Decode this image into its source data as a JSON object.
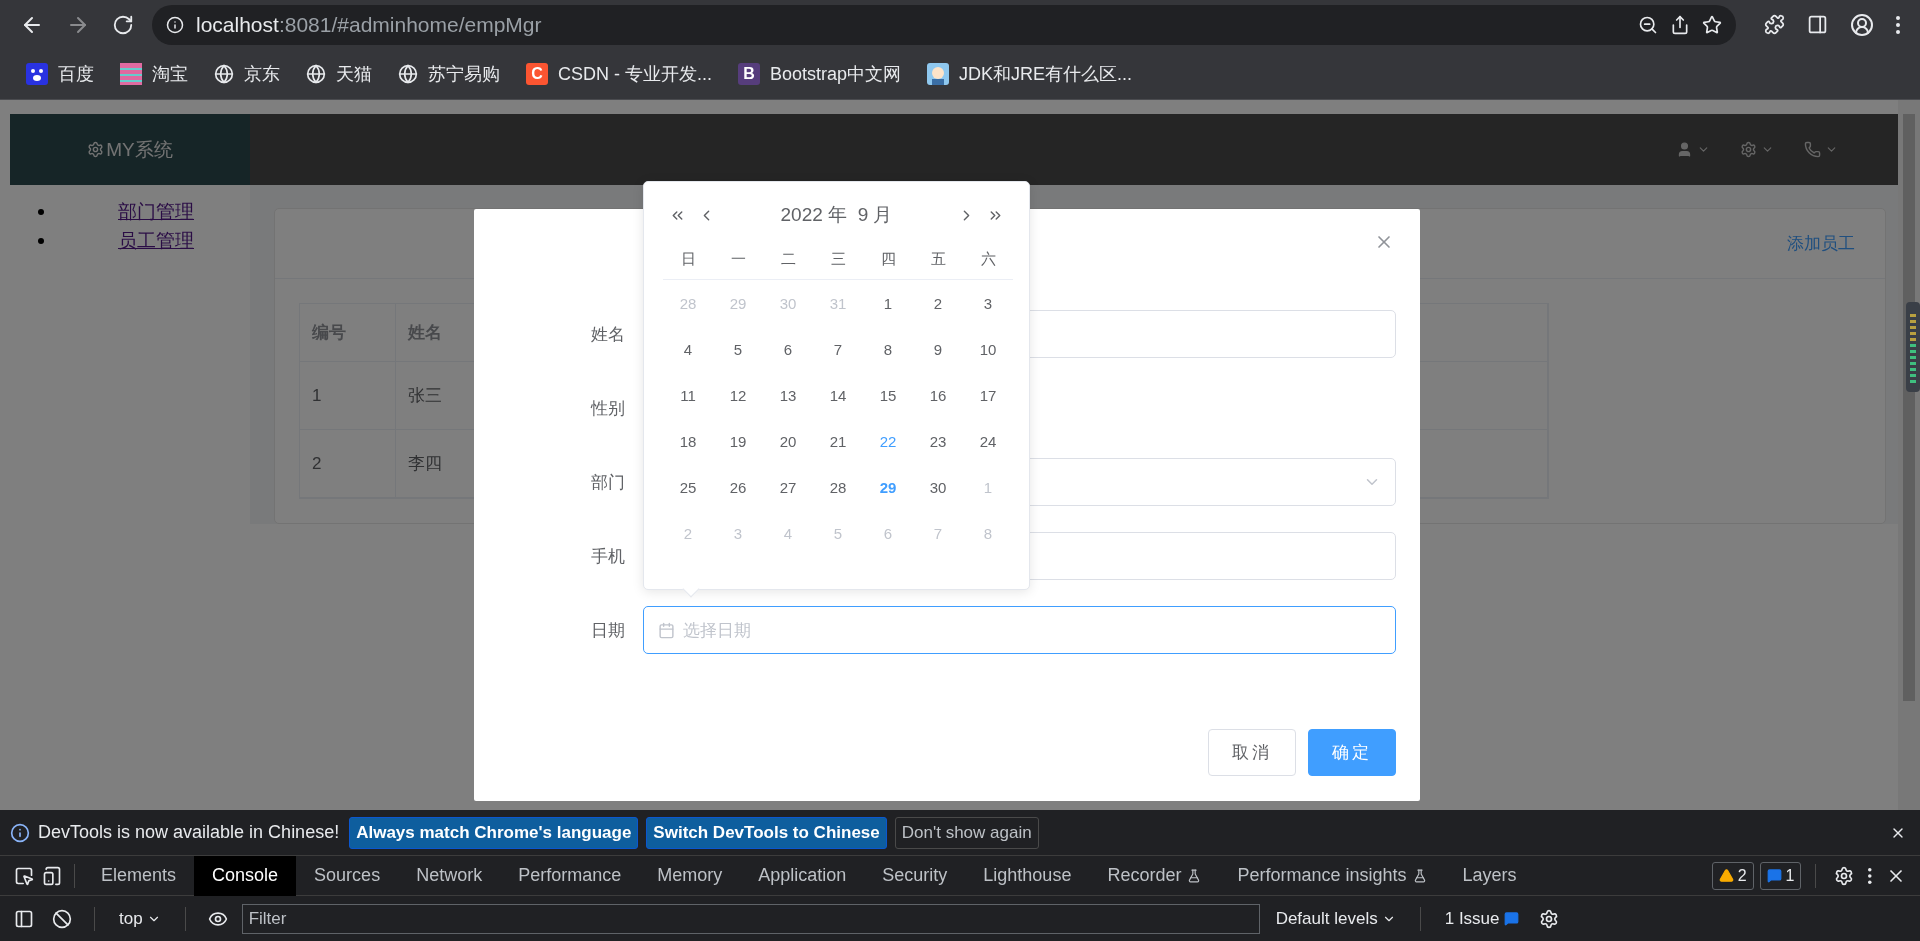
{
  "browser": {
    "url_host": "localhost",
    "url_path": ":8081/#adminhome/empMgr",
    "bookmarks": [
      {
        "label": "百度",
        "kind": "paw"
      },
      {
        "label": "淘宝",
        "kind": "pattern"
      },
      {
        "label": "京东",
        "kind": "globe"
      },
      {
        "label": "天猫",
        "kind": "globe"
      },
      {
        "label": "苏宁易购",
        "kind": "globe"
      },
      {
        "label": "CSDN - 专业开发...",
        "kind": "letter",
        "letter": "C",
        "color": "#fc5531"
      },
      {
        "label": "Bootstrap中文网",
        "kind": "letter",
        "letter": "B",
        "color": "#563d7c"
      },
      {
        "label": "JDK和JRE有什么区...",
        "kind": "avatar"
      }
    ]
  },
  "app": {
    "logo": "MY系统",
    "sidebar": [
      "部门管理",
      "员工管理"
    ],
    "card_action": "添加员工",
    "table": {
      "columns": [
        "编号",
        "姓名"
      ],
      "rows": [
        [
          "1",
          "张三"
        ],
        [
          "2",
          "李四"
        ]
      ]
    }
  },
  "dialog": {
    "fields": [
      {
        "label": "姓名",
        "kind": "input"
      },
      {
        "label": "性别",
        "kind": "covered"
      },
      {
        "label": "部门",
        "kind": "select"
      },
      {
        "label": "手机",
        "kind": "input"
      },
      {
        "label": "日期",
        "kind": "date",
        "placeholder": "选择日期"
      }
    ],
    "buttons": [
      {
        "label": "取消",
        "kind": "default"
      },
      {
        "label": "确定",
        "kind": "primary"
      }
    ]
  },
  "datepicker": {
    "year": "2022 年",
    "month": "9 月",
    "weekdays": [
      "日",
      "一",
      "二",
      "三",
      "四",
      "五",
      "六"
    ],
    "weeks": [
      [
        {
          "label": "28",
          "kind": "other"
        },
        {
          "label": "29",
          "kind": "other"
        },
        {
          "label": "30",
          "kind": "other"
        },
        {
          "label": "31",
          "kind": "other"
        },
        {
          "label": "1",
          "kind": "normal"
        },
        {
          "label": "2",
          "kind": "normal"
        },
        {
          "label": "3",
          "kind": "normal"
        }
      ],
      [
        {
          "label": "4",
          "kind": "normal"
        },
        {
          "label": "5",
          "kind": "normal"
        },
        {
          "label": "6",
          "kind": "normal"
        },
        {
          "label": "7",
          "kind": "normal"
        },
        {
          "label": "8",
          "kind": "normal"
        },
        {
          "label": "9",
          "kind": "normal"
        },
        {
          "label": "10",
          "kind": "normal"
        }
      ],
      [
        {
          "label": "11",
          "kind": "normal"
        },
        {
          "label": "12",
          "kind": "normal"
        },
        {
          "label": "13",
          "kind": "normal"
        },
        {
          "label": "14",
          "kind": "normal"
        },
        {
          "label": "15",
          "kind": "normal"
        },
        {
          "label": "16",
          "kind": "normal"
        },
        {
          "label": "17",
          "kind": "normal"
        }
      ],
      [
        {
          "label": "18",
          "kind": "normal"
        },
        {
          "label": "19",
          "kind": "normal"
        },
        {
          "label": "20",
          "kind": "normal"
        },
        {
          "label": "21",
          "kind": "normal"
        },
        {
          "label": "22",
          "kind": "marked"
        },
        {
          "label": "23",
          "kind": "normal"
        },
        {
          "label": "24",
          "kind": "normal"
        }
      ],
      [
        {
          "label": "25",
          "kind": "normal"
        },
        {
          "label": "26",
          "kind": "normal"
        },
        {
          "label": "27",
          "kind": "normal"
        },
        {
          "label": "28",
          "kind": "normal"
        },
        {
          "label": "29",
          "kind": "today"
        },
        {
          "label": "30",
          "kind": "normal"
        },
        {
          "label": "1",
          "kind": "other"
        }
      ],
      [
        {
          "label": "2",
          "kind": "other"
        },
        {
          "label": "3",
          "kind": "other"
        },
        {
          "label": "4",
          "kind": "other"
        },
        {
          "label": "5",
          "kind": "other"
        },
        {
          "label": "6",
          "kind": "other"
        },
        {
          "label": "7",
          "kind": "other"
        },
        {
          "label": "8",
          "kind": "other"
        }
      ]
    ]
  },
  "devtools": {
    "notice": "DevTools is now available in Chinese!",
    "notice_buttons": [
      {
        "label": "Always match Chrome's language",
        "kind": "primary"
      },
      {
        "label": "Switch DevTools to Chinese",
        "kind": "primary"
      },
      {
        "label": "Don't show again",
        "kind": "plain"
      }
    ],
    "tabs": [
      {
        "label": "Elements",
        "selected": false,
        "kind": "plain"
      },
      {
        "label": "Console",
        "selected": true,
        "kind": "plain"
      },
      {
        "label": "Sources",
        "selected": false,
        "kind": "plain"
      },
      {
        "label": "Network",
        "selected": false,
        "kind": "plain"
      },
      {
        "label": "Performance",
        "selected": false,
        "kind": "plain"
      },
      {
        "label": "Memory",
        "selected": false,
        "kind": "plain"
      },
      {
        "label": "Application",
        "selected": false,
        "kind": "plain"
      },
      {
        "label": "Security",
        "selected": false,
        "kind": "plain"
      },
      {
        "label": "Lighthouse",
        "selected": false,
        "kind": "plain"
      },
      {
        "label": "Recorder",
        "selected": false,
        "kind": "experimental"
      },
      {
        "label": "Performance insights",
        "selected": false,
        "kind": "experimental"
      },
      {
        "label": "Layers",
        "selected": false,
        "kind": "plain"
      }
    ],
    "warnings": "2",
    "messages": "1",
    "context": "top",
    "filter_placeholder": "Filter",
    "levels": "Default levels",
    "issues": "1 Issue"
  }
}
